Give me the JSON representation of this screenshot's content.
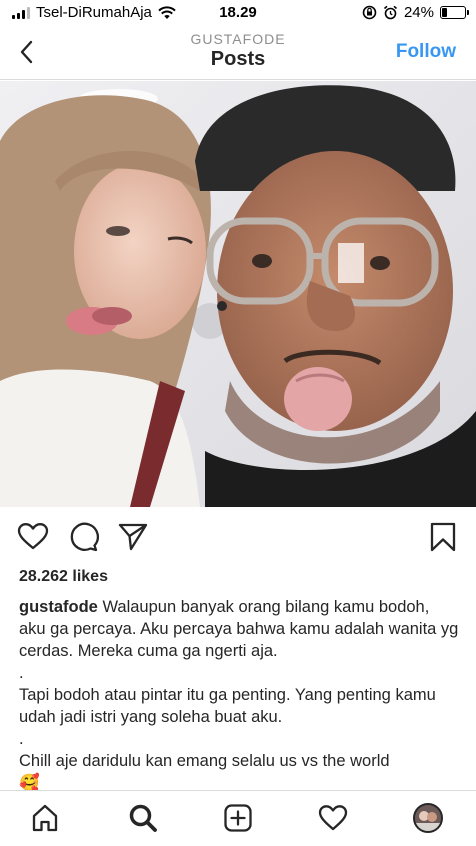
{
  "status_bar": {
    "carrier": "Tsel-DiRumahAja",
    "time": "18.29",
    "battery": "24%",
    "battery_level": 0.24
  },
  "header": {
    "username": "GUSTAFODE",
    "title": "Posts",
    "follow_label": "Follow"
  },
  "post": {
    "likes": "28.262 likes",
    "caption_username": "gustafode",
    "caption_lines": [
      "Walaupun  banyak orang bilang kamu bodoh, aku ga percaya. Aku percaya bahwa kamu adalah wanita yg cerdas. Mereka cuma ga ngerti aja.",
      ".",
      "Tapi bodoh atau pintar itu ga penting. Yang penting kamu udah jadi istri yang soleha buat aku.",
      ".",
      "Chill aje daridulu kan emang selalu us vs the world",
      "🥰"
    ]
  },
  "colors": {
    "accent": "#3897f0",
    "text": "#262626",
    "muted": "#8e8e8e",
    "divider": "#dbdbdb"
  },
  "icons": {
    "back": "chevron-left-icon",
    "like": "heart-icon",
    "comment": "comment-icon",
    "share": "send-icon",
    "save": "bookmark-icon",
    "home": "home-icon",
    "search": "search-icon",
    "new_post": "plus-square-icon",
    "activity": "heart-icon",
    "profile": "avatar"
  }
}
